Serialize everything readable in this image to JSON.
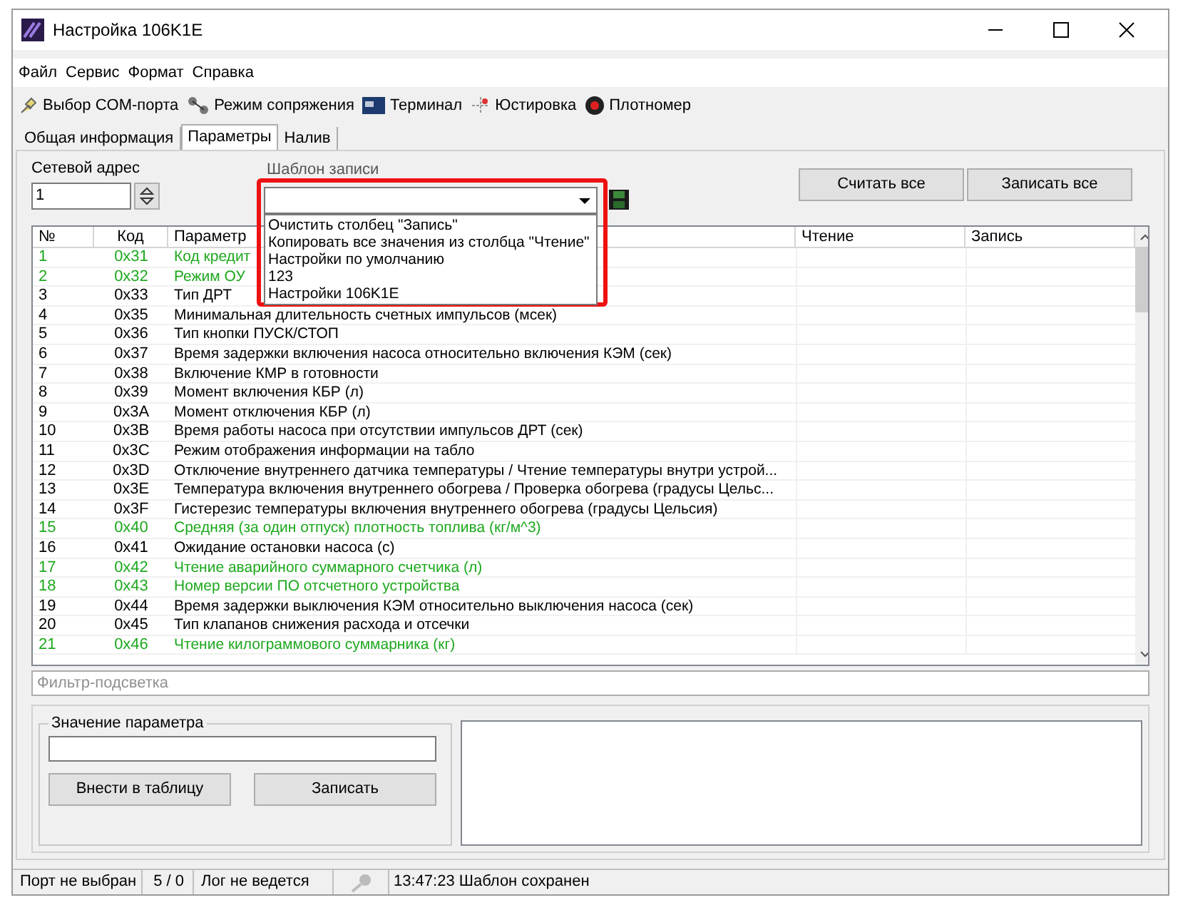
{
  "window": {
    "title": "Настройка 106K1E"
  },
  "menu": [
    "Файл",
    "Сервис",
    "Формат",
    "Справка"
  ],
  "toolbar": [
    {
      "label": "Выбор COM-порта",
      "kind": "plug"
    },
    {
      "label": "Режим сопряжения",
      "kind": "link"
    },
    {
      "label": "Терминал",
      "kind": "terminal"
    },
    {
      "label": "Юстировка",
      "kind": "tune"
    },
    {
      "label": "Плотномер",
      "kind": "meter"
    }
  ],
  "tabs": [
    {
      "label": "Общая информация",
      "selected": false
    },
    {
      "label": "Параметры",
      "selected": true
    },
    {
      "label": "Налив",
      "selected": false
    }
  ],
  "network_address": {
    "label": "Сетевой адрес",
    "value": "1"
  },
  "template": {
    "label": "Шаблон записи",
    "options": [
      "Очистить столбец \"Запись\"",
      "Копировать все значения из столбца \"Чтение\"",
      "Настройки по умолчанию",
      "123",
      "Настройки 106K1E"
    ]
  },
  "buttons": [
    "Считать все",
    "Записать все"
  ],
  "table": {
    "columns": [
      "№",
      "Код",
      "Параметр",
      "Чтение",
      "Запись"
    ],
    "rows": [
      {
        "n": "1",
        "code": "0x31",
        "param": "Код кредит",
        "color": "#1ea81e"
      },
      {
        "n": "2",
        "code": "0x32",
        "param": "Режим ОУ",
        "color": "#1ea81e"
      },
      {
        "n": "3",
        "code": "0x33",
        "param": "Тип ДРТ",
        "color": "#000000"
      },
      {
        "n": "4",
        "code": "0x35",
        "param": "Минимальная длительность счетных импульсов (мсек)",
        "color": "#000000"
      },
      {
        "n": "5",
        "code": "0x36",
        "param": "Тип кнопки ПУСК/СТОП",
        "color": "#000000"
      },
      {
        "n": "6",
        "code": "0x37",
        "param": "Время задержки включения насоса относительно включения КЭМ (сек)",
        "color": "#000000"
      },
      {
        "n": "7",
        "code": "0x38",
        "param": "Включение КМР в готовности",
        "color": "#000000"
      },
      {
        "n": "8",
        "code": "0x39",
        "param": "Момент включения КБР (л)",
        "color": "#000000"
      },
      {
        "n": "9",
        "code": "0x3A",
        "param": "Момент отключения КБР (л)",
        "color": "#000000"
      },
      {
        "n": "10",
        "code": "0x3B",
        "param": "Время работы насоса при отсутствии импульсов ДРТ (сек)",
        "color": "#000000"
      },
      {
        "n": "11",
        "code": "0x3C",
        "param": "Режим отображения информации на табло",
        "color": "#000000"
      },
      {
        "n": "12",
        "code": "0x3D",
        "param": "Отключение внутреннего датчика температуры / Чтение температуры внутри устрой...",
        "color": "#000000"
      },
      {
        "n": "13",
        "code": "0x3E",
        "param": "Температура включения внутреннего обогрева / Проверка обогрева (градусы Цельс...",
        "color": "#000000"
      },
      {
        "n": "14",
        "code": "0x3F",
        "param": "Гистерезис температуры включения внутреннего обогрева (градусы Цельсия)",
        "color": "#000000"
      },
      {
        "n": "15",
        "code": "0x40",
        "param": "Средняя (за один отпуск) плотность топлива (кг/м^3)",
        "color": "#1ea81e"
      },
      {
        "n": "16",
        "code": "0x41",
        "param": "Ожидание остановки насоса (с)",
        "color": "#000000"
      },
      {
        "n": "17",
        "code": "0x42",
        "param": "Чтение аварийного суммарного счетчика (л)",
        "color": "#1ea81e"
      },
      {
        "n": "18",
        "code": "0x43",
        "param": "Номер версии ПО отсчетного устройства",
        "color": "#1ea81e"
      },
      {
        "n": "19",
        "code": "0x44",
        "param": "Время задержки выключения КЭМ относительно выключения насоса (сек)",
        "color": "#000000"
      },
      {
        "n": "20",
        "code": "0x45",
        "param": "Тип клапанов снижения расхода и отсечки",
        "color": "#000000"
      },
      {
        "n": "21",
        "code": "0x46",
        "param": "Чтение килограммового суммарника (кг)",
        "color": "#1ea81e"
      }
    ]
  },
  "filter": {
    "placeholder": "Фильтр-подсветка"
  },
  "param_value": {
    "label": "Значение параметра",
    "buttons": [
      "Внести в таблицу",
      "Записать"
    ]
  },
  "status_bar": [
    "Порт не выбран",
    "5 / 0",
    "Лог не ведется",
    "13:47:23 Шаблон сохранен"
  ]
}
